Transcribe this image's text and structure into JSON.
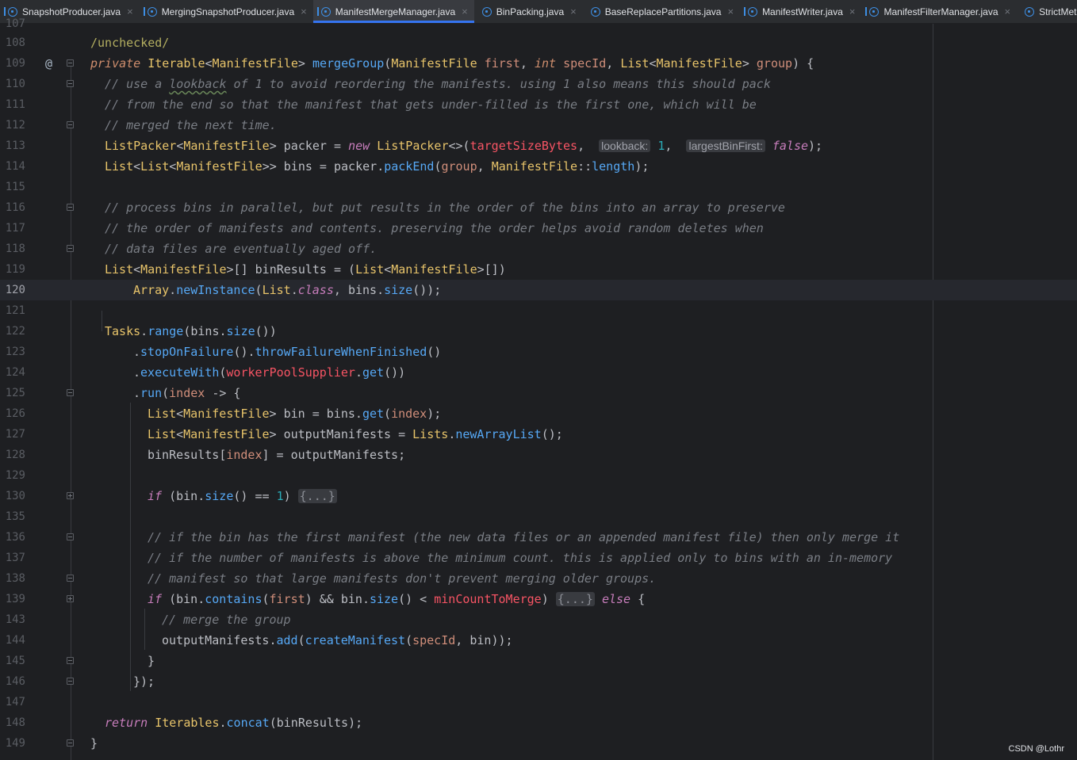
{
  "tabs": [
    {
      "label": "SnapshotProducer.java",
      "active": false
    },
    {
      "label": "MergingSnapshotProducer.java",
      "active": false
    },
    {
      "label": "ManifestMergeManager.java",
      "active": true
    },
    {
      "label": "BinPacking.java",
      "active": false
    },
    {
      "label": "BaseReplacePartitions.java",
      "active": false
    },
    {
      "label": "ManifestWriter.java",
      "active": false
    },
    {
      "label": "ManifestFilterManager.java",
      "active": false
    },
    {
      "label": "StrictMetricsEv",
      "active": false
    }
  ],
  "tab_close_glyph": "×",
  "gutter": {
    "override_marker": "@",
    "line_numbers": [
      "107",
      "108",
      "109",
      "110",
      "111",
      "112",
      "113",
      "114",
      "115",
      "116",
      "117",
      "118",
      "119",
      "120",
      "121",
      "122",
      "123",
      "124",
      "125",
      "126",
      "127",
      "128",
      "129",
      "130",
      "135",
      "136",
      "137",
      "138",
      "139",
      "143",
      "144",
      "145",
      "146",
      "147",
      "148",
      "149"
    ]
  },
  "code": {
    "l108_annotation": "/unchecked/",
    "l109": {
      "mod": "private",
      "ret_type": "Iterable",
      "ret_gen": "ManifestFile",
      "name": "mergeGroup",
      "p1_type": "ManifestFile",
      "p1": "first",
      "p2_type": "int",
      "p2": "specId",
      "p3_type": "List",
      "p3_gen": "ManifestFile",
      "p3": "group"
    },
    "l110": {
      "pre": "// use a ",
      "squiggle": "lookback",
      "post": " of 1 to avoid reordering the manifests. using 1 also means this should pack"
    },
    "l111": "// from the end so that the manifest that gets under-filled is the first one, which will be",
    "l112": "// merged the next time.",
    "l113": {
      "type": "ListPacker",
      "gen": "ManifestFile",
      "var": "packer",
      "new": "new",
      "ctor": "ListPacker",
      "arg1": "targetSizeBytes",
      "hint1": "lookback:",
      "arg2": "1",
      "hint2": "largestBinFirst:",
      "arg3": "false"
    },
    "l114": {
      "type": "List",
      "gen1": "List",
      "gen2": "ManifestFile",
      "var": "bins",
      "obj": "packer",
      "method": "packEnd",
      "arg1": "group",
      "ref_cls": "ManifestFile",
      "ref_m": "length"
    },
    "l116": "// process bins in parallel, but put results in the order of the bins into an array to preserve",
    "l117": "// the order of manifests and contents. preserving the order helps avoid random deletes when",
    "l118": "// data files are eventually aged off.",
    "l119": {
      "type": "List",
      "gen": "ManifestFile",
      "var": "binResults",
      "cast_type": "List",
      "cast_gen": "ManifestFile"
    },
    "l120": {
      "cls": "Array",
      "m": "newInstance",
      "arg_cls": "List",
      "arg_kw": "class",
      "obj": "bins",
      "m2": "size"
    },
    "l122": {
      "cls": "Tasks",
      "m": "range",
      "obj": "bins",
      "m2": "size"
    },
    "l123": {
      "m1": "stopOnFailure",
      "m2": "throwFailureWhenFinished"
    },
    "l124": {
      "m": "executeWith",
      "field": "workerPoolSupplier",
      "m2": "get"
    },
    "l125": {
      "m": "run",
      "param": "index"
    },
    "l126": {
      "type": "List",
      "gen": "ManifestFile",
      "var": "bin",
      "obj": "bins",
      "m": "get",
      "arg": "index"
    },
    "l127": {
      "type": "List",
      "gen": "ManifestFile",
      "var": "outputManifests",
      "cls": "Lists",
      "m": "newArrayList"
    },
    "l128": {
      "arr": "binResults",
      "idx": "index",
      "val": "outputManifests"
    },
    "l130": {
      "kw": "if",
      "obj": "bin",
      "m": "size",
      "num": "1",
      "folded": "{...}"
    },
    "l136": "// if the bin has the first manifest (the new data files or an appended manifest file) then only merge it",
    "l137": "// if the number of manifests is above the minimum count. this is applied only to bins with an in-memory",
    "l138": "// manifest so that large manifests don't prevent merging older groups.",
    "l139": {
      "kw": "if",
      "obj": "bin",
      "m": "contains",
      "arg": "first",
      "obj2": "bin",
      "m2": "size",
      "field": "minCountToMerge",
      "folded": "{...}",
      "else": "else"
    },
    "l143": "// merge the group",
    "l144": {
      "obj": "outputManifests",
      "m": "add",
      "m2": "createManifest",
      "arg1": "specId",
      "arg2": "bin"
    },
    "l145": "}",
    "l146": "});",
    "l148": {
      "kw": "return",
      "cls": "Iterables",
      "m": "concat",
      "arg": "binResults"
    },
    "l149": "}"
  },
  "watermark": "CSDN @Lothr"
}
